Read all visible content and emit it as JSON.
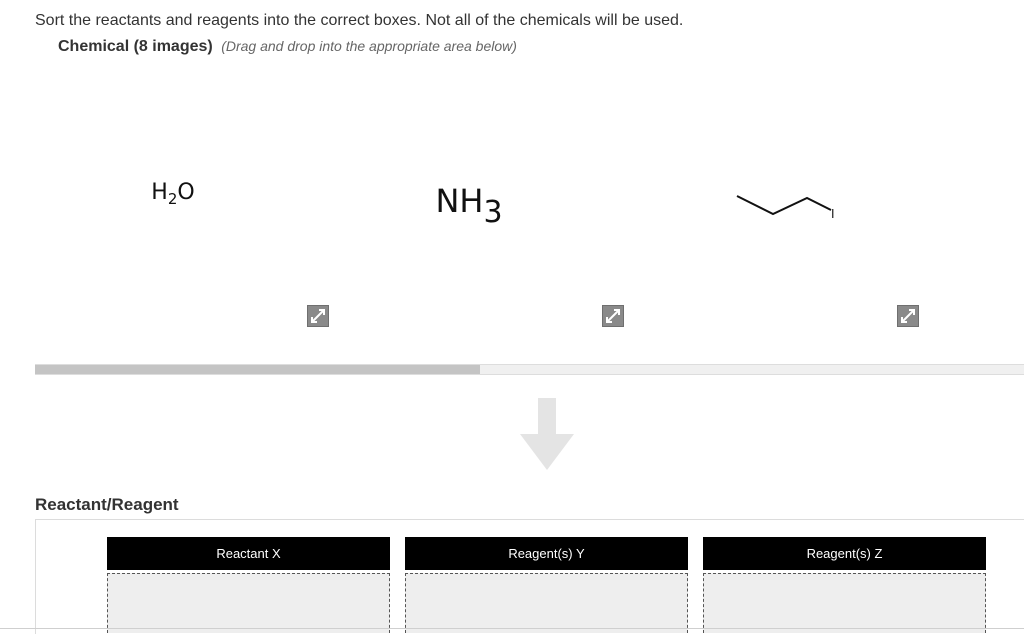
{
  "instructions": "Sort the reactants and reagents into the correct boxes. Not all of the chemicals will be used.",
  "subhead": {
    "title": "Chemical (8 images)",
    "hint": "(Drag and drop into the appropriate area below)"
  },
  "chemicals": [
    {
      "formula_main": "H",
      "formula_sub": "2",
      "formula_tail": "O"
    },
    {
      "formula_main": "NH",
      "formula_sub": "3"
    },
    {
      "structure_label": "I"
    }
  ],
  "tray": {
    "scroll_fraction": 0.45
  },
  "section_label": "Reactant/Reagent",
  "bins": [
    {
      "label": "Reactant X"
    },
    {
      "label": "Reagent(s) Y"
    },
    {
      "label": "Reagent(s) Z"
    }
  ],
  "colors": {
    "bin_header": "#000000",
    "bin_body": "#eeeeee",
    "expand_button": "#8a8a8a"
  },
  "icons": [
    "expand-icon",
    "down-arrow-icon"
  ]
}
